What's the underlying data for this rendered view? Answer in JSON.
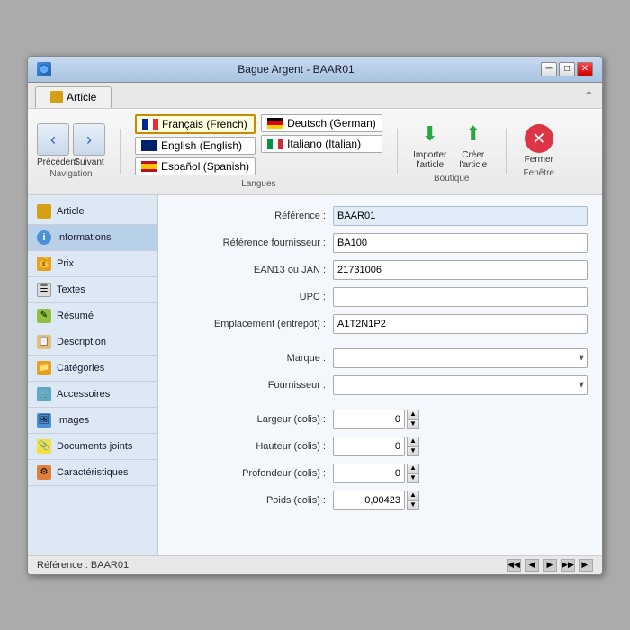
{
  "window": {
    "title": "Bague Argent - BAAR01",
    "icon": "app-icon"
  },
  "tabs": [
    {
      "id": "article",
      "label": "Article",
      "active": true
    }
  ],
  "toolbar": {
    "navigation": {
      "label": "Navigation",
      "prev_label": "Précédent",
      "next_label": "Suivant"
    },
    "languages": {
      "label": "Langues",
      "items": [
        {
          "id": "fr",
          "name": "Français (French)",
          "selected": true
        },
        {
          "id": "en",
          "name": "English (English)",
          "selected": false
        },
        {
          "id": "es",
          "name": "Español (Spanish)",
          "selected": false
        },
        {
          "id": "de",
          "name": "Deutsch (German)",
          "selected": false
        },
        {
          "id": "it",
          "name": "Italiano (Italian)",
          "selected": false
        }
      ]
    },
    "boutique": {
      "label": "Boutique",
      "import_label": "Importer\nl'article",
      "create_label": "Créer\nl'article"
    },
    "window": {
      "label": "Fenêtre",
      "close_label": "Fermer"
    }
  },
  "sidebar": {
    "items": [
      {
        "id": "article",
        "label": "Article",
        "icon": "article"
      },
      {
        "id": "informations",
        "label": "Informations",
        "icon": "info",
        "active": true
      },
      {
        "id": "prix",
        "label": "Prix",
        "icon": "prix"
      },
      {
        "id": "textes",
        "label": "Textes",
        "icon": "textes"
      },
      {
        "id": "resume",
        "label": "Résumé",
        "icon": "resume"
      },
      {
        "id": "description",
        "label": "Description",
        "icon": "desc"
      },
      {
        "id": "categories",
        "label": "Catégories",
        "icon": "cat"
      },
      {
        "id": "accessoires",
        "label": "Accessoires",
        "icon": "acc"
      },
      {
        "id": "images",
        "label": "Images",
        "icon": "img"
      },
      {
        "id": "documents",
        "label": "Documents joints",
        "icon": "docs"
      },
      {
        "id": "caracteristiques",
        "label": "Caractéristiques",
        "icon": "char"
      }
    ]
  },
  "form": {
    "fields": [
      {
        "id": "reference",
        "label": "Référence :",
        "value": "BAAR01",
        "type": "text",
        "style": "blue"
      },
      {
        "id": "ref_fournisseur",
        "label": "Référence fournisseur :",
        "value": "BA100",
        "type": "text"
      },
      {
        "id": "ean13",
        "label": "EAN13 ou JAN :",
        "value": "21731006",
        "type": "text"
      },
      {
        "id": "upc",
        "label": "UPC :",
        "value": "",
        "type": "text"
      },
      {
        "id": "emplacement",
        "label": "Emplacement (entrepôt) :",
        "value": "A1T2N1P2",
        "type": "text"
      }
    ],
    "selects": [
      {
        "id": "marque",
        "label": "Marque :"
      },
      {
        "id": "fournisseur",
        "label": "Fournisseur :"
      }
    ],
    "spinners": [
      {
        "id": "largeur",
        "label": "Largeur (colis) :",
        "value": "0"
      },
      {
        "id": "hauteur",
        "label": "Hauteur (colis) :",
        "value": "0"
      },
      {
        "id": "profondeur",
        "label": "Profondeur (colis) :",
        "value": "0"
      },
      {
        "id": "poids",
        "label": "Poids (colis) :",
        "value": "0,00423"
      }
    ]
  },
  "status": {
    "text": "Référence : BAAR01",
    "nav_buttons": [
      "◀◀",
      "◀",
      "▶",
      "▶▶",
      "▶|"
    ]
  }
}
